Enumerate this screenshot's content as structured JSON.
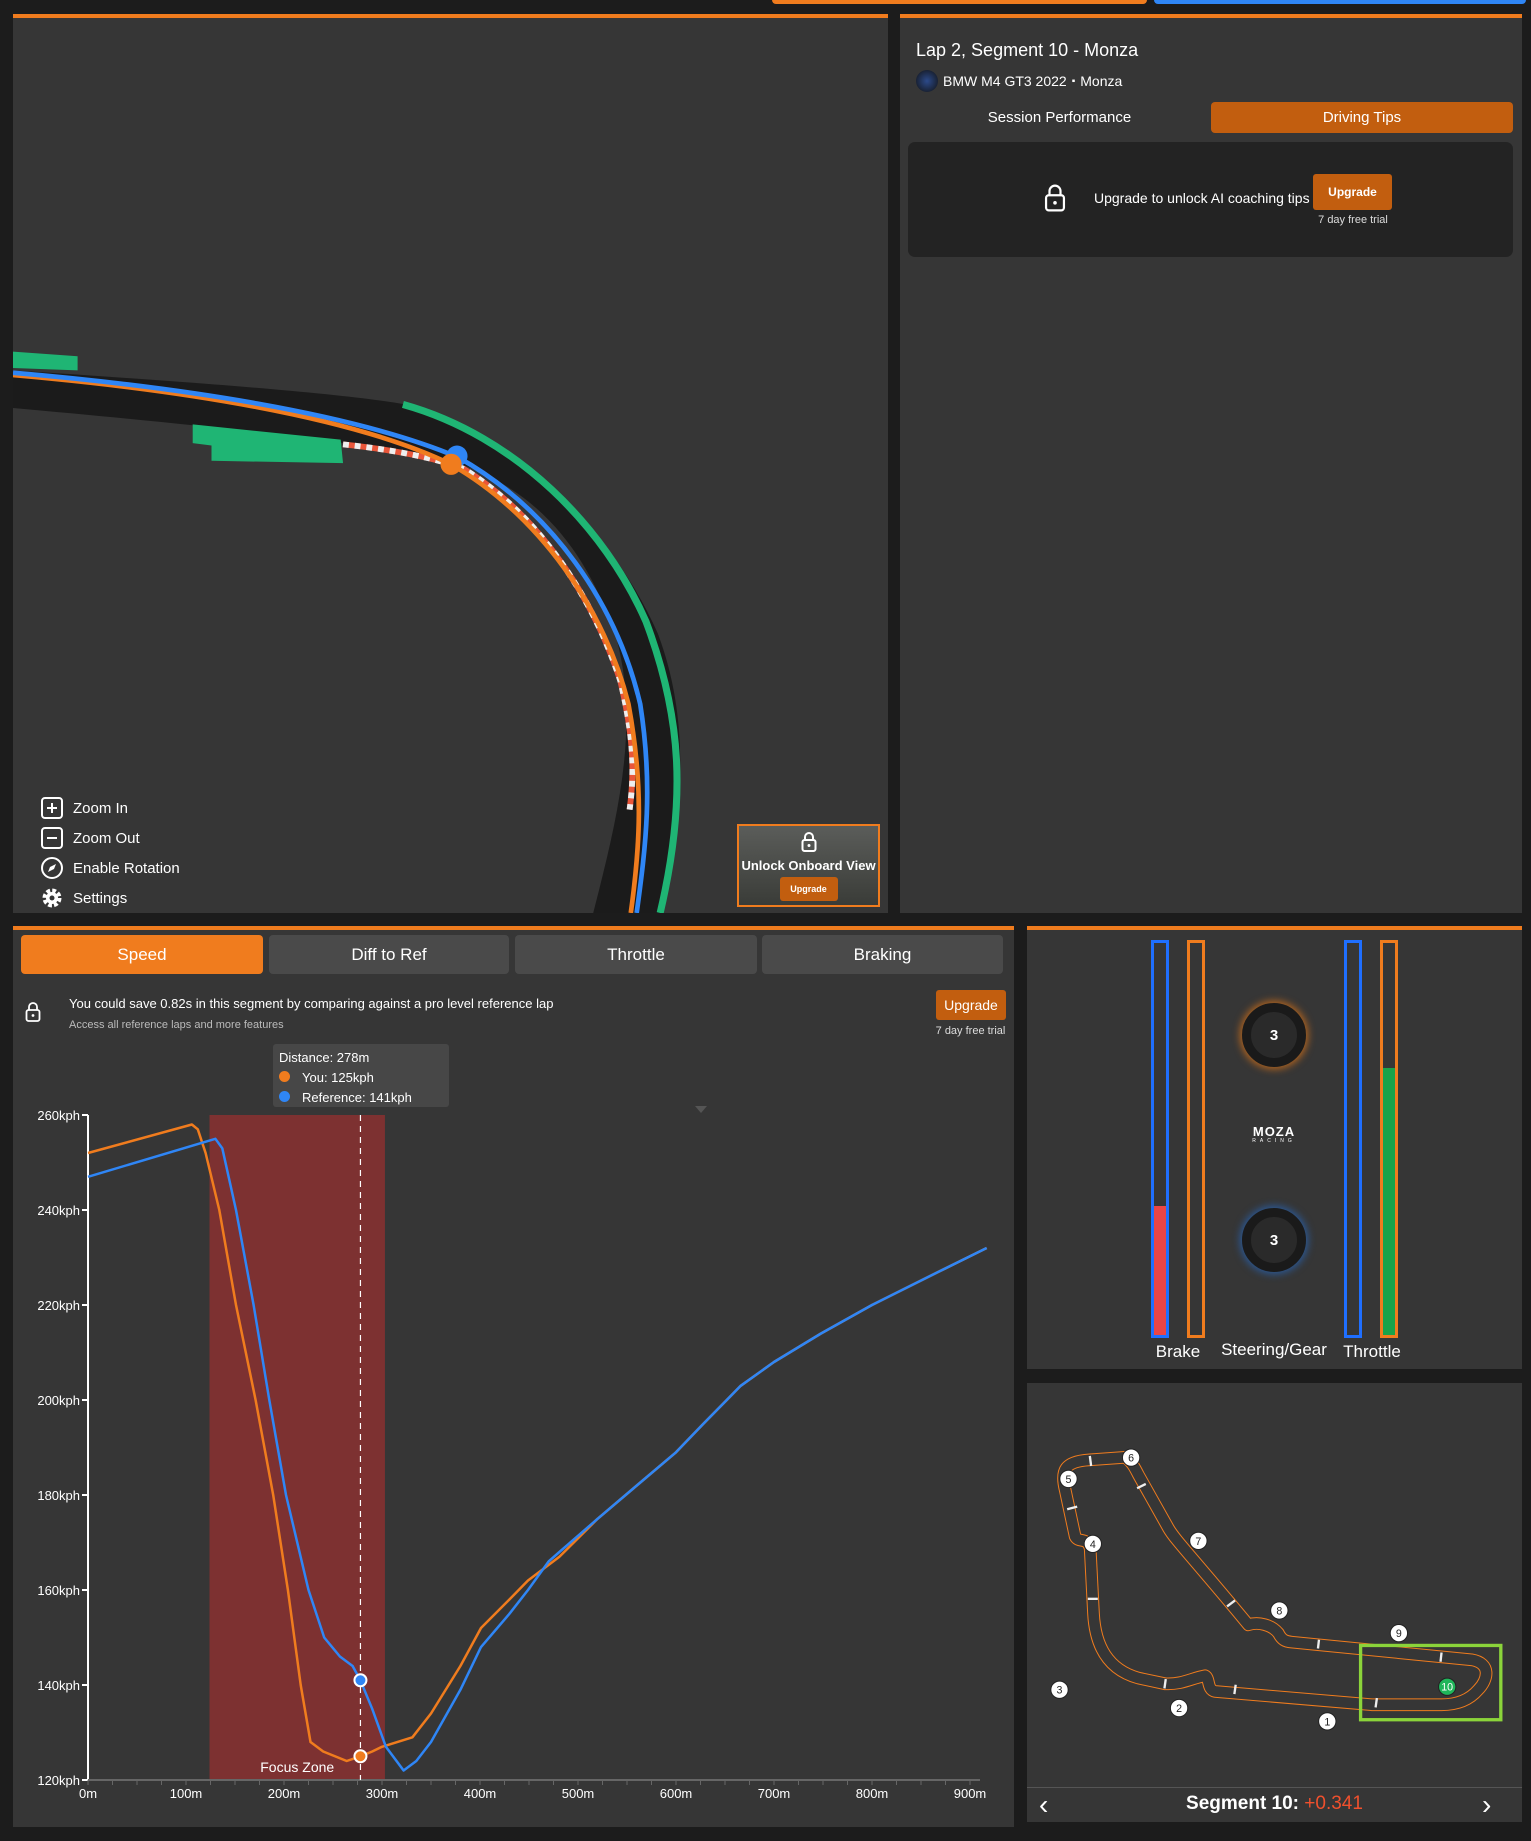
{
  "colors": {
    "accent": "#f07c1e",
    "you": "#f07c1e",
    "reference": "#2f86f6",
    "focus_zone": "#7d3131",
    "upgrade": "#c25e0f",
    "delta": "#f0502d",
    "kerb_green": "#1fb574",
    "segment_highlight": "#8bd43a"
  },
  "map": {
    "controls": [
      {
        "label": "Zoom In",
        "icon": "plus-square-icon"
      },
      {
        "label": "Zoom Out",
        "icon": "minus-square-icon"
      },
      {
        "label": "Enable Rotation",
        "icon": "compass-icon"
      },
      {
        "label": "Settings",
        "icon": "gear-icon"
      }
    ],
    "onboard": {
      "label": "Unlock Onboard View",
      "button": "Upgrade",
      "icon": "lock-icon"
    }
  },
  "session": {
    "title": "Lap 2, Segment 10 - Monza",
    "car": "BMW M4 GT3 2022",
    "separator": "▪",
    "track": "Monza",
    "tabs": [
      {
        "label": "Session Performance",
        "active": false
      },
      {
        "label": "Driving Tips",
        "active": true
      }
    ],
    "locked": {
      "message": "Upgrade to unlock AI coaching tips",
      "button": "Upgrade",
      "trial": "7 day free trial",
      "icon": "lock-icon"
    }
  },
  "chart_panel": {
    "tabs": [
      {
        "label": "Speed",
        "active": true
      },
      {
        "label": "Diff to Ref",
        "active": false
      },
      {
        "label": "Throttle",
        "active": false
      },
      {
        "label": "Braking",
        "active": false
      }
    ],
    "promo": {
      "message": "You could save 0.82s in this segment by comparing against a pro level reference lap",
      "sub": "Access all reference laps and more features",
      "button": "Upgrade",
      "trial": "7 day free trial"
    },
    "tooltip": {
      "distance": "Distance: 278m",
      "you": "You: 125kph",
      "reference": "Reference: 141kph"
    }
  },
  "chart_data": {
    "type": "line",
    "xlabel": "",
    "ylabel": "",
    "xlim": [
      0,
      900
    ],
    "ylim": [
      120,
      260
    ],
    "x_ticks": [
      "0m",
      "100m",
      "200m",
      "300m",
      "400m",
      "500m",
      "600m",
      "700m",
      "800m",
      "900m"
    ],
    "y_ticks": [
      "120kph",
      "140kph",
      "160kph",
      "180kph",
      "200kph",
      "220kph",
      "240kph",
      "260kph"
    ],
    "grid": false,
    "focus_zone": {
      "label": "Focus Zone",
      "from": 124,
      "to": 303
    },
    "cursor": {
      "x": 278,
      "you": 125,
      "reference": 141
    },
    "series": [
      {
        "name": "You",
        "color": "#f07c1e",
        "points": [
          [
            0,
            252
          ],
          [
            106,
            258
          ],
          [
            112,
            257
          ],
          [
            120,
            252
          ],
          [
            134,
            240
          ],
          [
            151,
            220
          ],
          [
            171,
            200
          ],
          [
            189,
            180
          ],
          [
            204,
            160
          ],
          [
            217,
            140
          ],
          [
            227,
            128
          ],
          [
            240,
            126
          ],
          [
            264,
            124
          ],
          [
            278,
            125
          ],
          [
            290,
            126
          ],
          [
            300,
            127
          ],
          [
            331,
            129
          ],
          [
            350,
            134
          ],
          [
            380,
            144
          ],
          [
            401,
            152
          ],
          [
            430,
            158
          ],
          [
            449,
            162
          ],
          [
            481,
            167
          ],
          [
            520,
            175
          ],
          [
            560,
            182
          ],
          [
            600,
            189
          ],
          [
            628,
            195
          ],
          [
            666,
            203
          ],
          [
            700,
            208
          ],
          [
            748,
            214
          ],
          [
            800,
            220
          ],
          [
            868,
            227
          ],
          [
            917,
            232
          ]
        ]
      },
      {
        "name": "Reference",
        "color": "#2f86f6",
        "points": [
          [
            0,
            247
          ],
          [
            130,
            255
          ],
          [
            137,
            253
          ],
          [
            151,
            240
          ],
          [
            169,
            220
          ],
          [
            185,
            200
          ],
          [
            202,
            180
          ],
          [
            225,
            160
          ],
          [
            241,
            150
          ],
          [
            257,
            146
          ],
          [
            270,
            144
          ],
          [
            278,
            141
          ],
          [
            290,
            135
          ],
          [
            304,
            127
          ],
          [
            322,
            122
          ],
          [
            335,
            124
          ],
          [
            350,
            128
          ],
          [
            380,
            139
          ],
          [
            401,
            148
          ],
          [
            430,
            155
          ],
          [
            449,
            160
          ],
          [
            470,
            166
          ],
          [
            481,
            168
          ],
          [
            520,
            175
          ],
          [
            560,
            182
          ],
          [
            600,
            189
          ],
          [
            628,
            195
          ],
          [
            666,
            203
          ],
          [
            700,
            208
          ],
          [
            748,
            214
          ],
          [
            800,
            220
          ],
          [
            868,
            227
          ],
          [
            917,
            232
          ]
        ]
      }
    ]
  },
  "inputs": {
    "brake": {
      "label": "Brake",
      "reference": 0.33,
      "you": 0.0
    },
    "steering": {
      "label": "Steering/Gear",
      "you_gear": "3",
      "reference_gear": "3",
      "brand": "MOZA",
      "brand_sub": "RACING"
    },
    "throttle": {
      "label": "Throttle",
      "reference": 0.0,
      "you": 0.68
    }
  },
  "track_map": {
    "corners": [
      "1",
      "2",
      "3",
      "4",
      "5",
      "6",
      "7",
      "8",
      "9",
      "10"
    ],
    "active_segment": "10",
    "segment_label": "Segment 10:",
    "delta": "+0.341"
  }
}
